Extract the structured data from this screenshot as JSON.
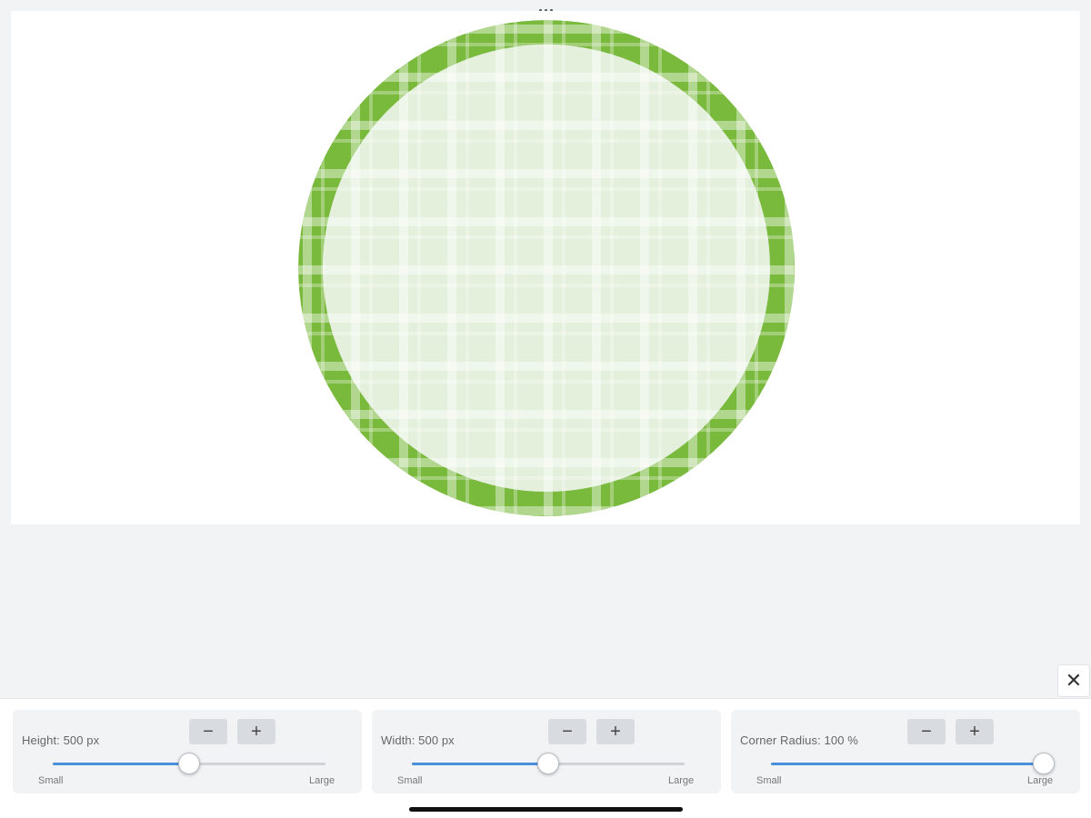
{
  "colors": {
    "rim_green": "#79b93c",
    "inner_fill": "#e4efdc",
    "slider_accent": "#4a8fdc"
  },
  "icons": {
    "more": "more-dots-icon",
    "close": "close-icon",
    "minus": "minus-icon",
    "plus": "plus-icon"
  },
  "close_button": {
    "label": "✕"
  },
  "controls": [
    {
      "label": "Height: 500 px",
      "minus": "−",
      "plus": "+",
      "min_label": "Small",
      "max_label": "Large",
      "level": 0.5
    },
    {
      "label": "Width: 500 px",
      "minus": "−",
      "plus": "+",
      "min_label": "Small",
      "max_label": "Large",
      "level": 0.5
    },
    {
      "label": "Corner Radius: 100 %",
      "minus": "−",
      "plus": "+",
      "min_label": "Small",
      "max_label": "Large",
      "level": 1.0
    }
  ]
}
